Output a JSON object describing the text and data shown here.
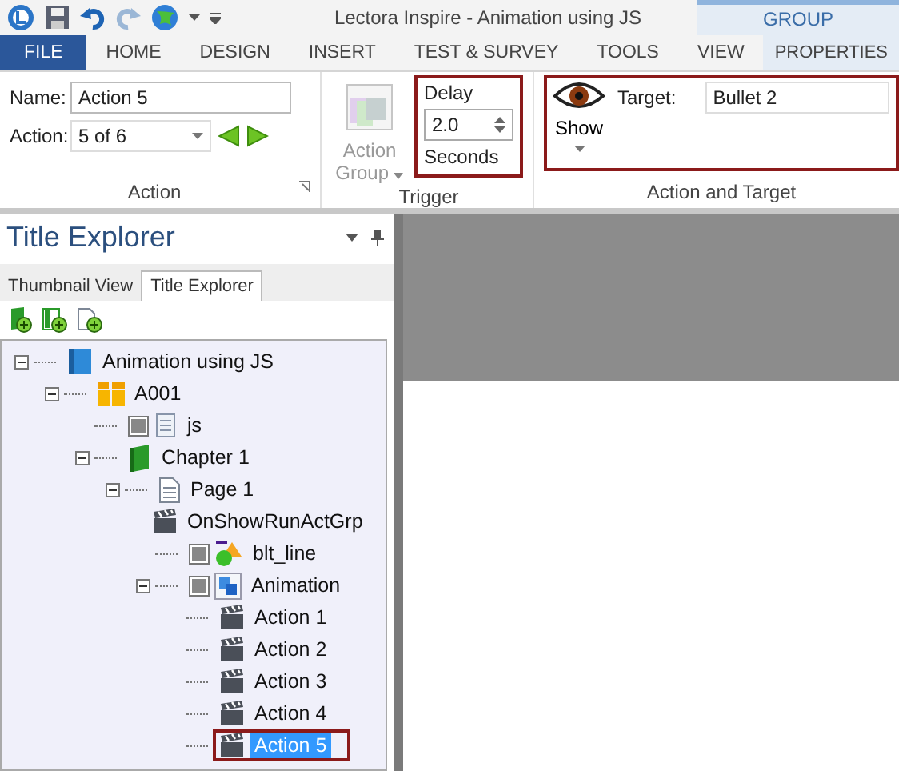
{
  "window": {
    "title": "Lectora Inspire - Animation using JS",
    "context_tab_group": "GROUP"
  },
  "ribbon_tabs": [
    {
      "label": "FILE",
      "kind": "file",
      "selected": false
    },
    {
      "label": "HOME",
      "kind": "tab",
      "selected": false
    },
    {
      "label": "DESIGN",
      "kind": "tab",
      "selected": false
    },
    {
      "label": "INSERT",
      "kind": "tab",
      "selected": false
    },
    {
      "label": "TEST & SURVEY",
      "kind": "tab",
      "selected": false
    },
    {
      "label": "TOOLS",
      "kind": "tab",
      "selected": false
    },
    {
      "label": "VIEW",
      "kind": "tab",
      "selected": false
    },
    {
      "label": "PROPERTIES",
      "kind": "context",
      "selected": true
    }
  ],
  "ribbon": {
    "action": {
      "label": "Action",
      "name_label": "Name:",
      "name_value": "Action 5",
      "action_label": "Action:",
      "action_value": "5 of 6"
    },
    "trigger": {
      "label": "Trigger",
      "action_group_button": {
        "label": "Action Group",
        "disabled": true
      },
      "delay": {
        "label": "Delay",
        "value": "2.0",
        "unit": "Seconds",
        "highlighted": true
      }
    },
    "target": {
      "label": "Action and Target",
      "show_button": "Show",
      "target_label": "Target:",
      "target_value": "Bullet 2",
      "highlighted": true
    }
  },
  "panel": {
    "title": "Title Explorer",
    "tabs": [
      {
        "label": "Thumbnail View",
        "selected": false
      },
      {
        "label": "Title Explorer",
        "selected": true
      }
    ],
    "tree": [
      {
        "label": "Animation using JS",
        "kind": "title",
        "expanded": true,
        "selected": false,
        "highlighted": false,
        "children": [
          {
            "label": "A001",
            "kind": "assignable",
            "expanded": true,
            "selected": false,
            "highlighted": false,
            "children": [
              {
                "label": "js",
                "kind": "script",
                "selected": false,
                "highlighted": false
              },
              {
                "label": "Chapter 1",
                "kind": "chapter",
                "expanded": true,
                "selected": false,
                "highlighted": false,
                "children": [
                  {
                    "label": "Page 1",
                    "kind": "page",
                    "expanded": true,
                    "selected": false,
                    "highlighted": false,
                    "children": [
                      {
                        "label": "OnShowRunActGrp",
                        "kind": "action",
                        "selected": false,
                        "highlighted": false
                      },
                      {
                        "label": "blt_line",
                        "kind": "shape",
                        "selected": false,
                        "highlighted": false
                      },
                      {
                        "label": "Animation",
                        "kind": "group",
                        "expanded": true,
                        "selected": false,
                        "highlighted": false,
                        "children": [
                          {
                            "label": "Action 1",
                            "kind": "action",
                            "selected": false,
                            "highlighted": false
                          },
                          {
                            "label": "Action 2",
                            "kind": "action",
                            "selected": false,
                            "highlighted": false
                          },
                          {
                            "label": "Action 3",
                            "kind": "action",
                            "selected": false,
                            "highlighted": false
                          },
                          {
                            "label": "Action 4",
                            "kind": "action",
                            "selected": false,
                            "highlighted": false
                          },
                          {
                            "label": "Action 5",
                            "kind": "action",
                            "selected": true,
                            "highlighted": true
                          }
                        ]
                      }
                    ]
                  }
                ]
              }
            ]
          }
        ]
      }
    ]
  }
}
